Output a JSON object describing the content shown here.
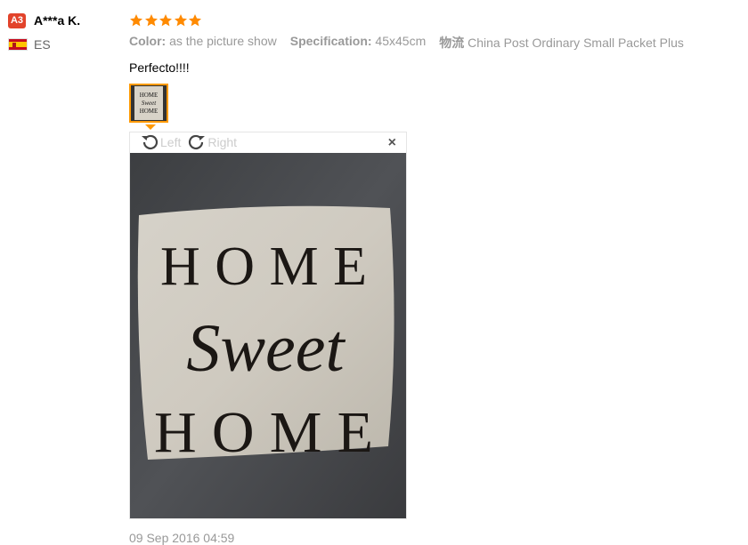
{
  "user": {
    "level_badge": "A3",
    "name": "A***a K.",
    "country": "ES"
  },
  "review": {
    "stars": 5,
    "color_label": "Color:",
    "color_value": "as the picture show",
    "spec_label": "Specification:",
    "spec_value": "45x45cm",
    "shipping_label": "物流",
    "shipping_value": "China Post Ordinary Small Packet Plus",
    "text": "Perfecto!!!!",
    "date": "09 Sep 2016 04:59"
  },
  "viewer": {
    "rotate_left": "Left",
    "rotate_right": "Right",
    "close": "×"
  },
  "photo": {
    "line1": "HOME",
    "line2": "Sweet",
    "line3": "HOME"
  },
  "colors": {
    "badge": "#e2432b",
    "star": "#ff8a00",
    "accent": "#ff9900",
    "meta": "#999999"
  }
}
